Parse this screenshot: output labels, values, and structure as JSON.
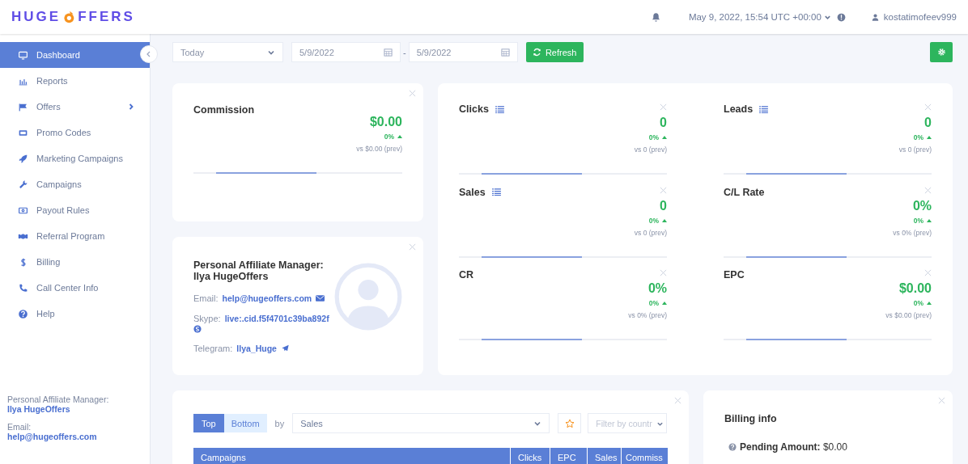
{
  "logo": {
    "left": "HUGE",
    "right": "FFERS"
  },
  "header": {
    "datetime": "May 9, 2022, 15:54 UTC +00:00",
    "user": "kostatimofeev999"
  },
  "sidebar": {
    "items": [
      {
        "label": "Dashboard",
        "selected": true,
        "has_submenu": false
      },
      {
        "label": "Reports",
        "selected": false,
        "has_submenu": false
      },
      {
        "label": "Offers",
        "selected": false,
        "has_submenu": true
      },
      {
        "label": "Promo Codes",
        "selected": false,
        "has_submenu": false
      },
      {
        "label": "Marketing Campaigns",
        "selected": false,
        "has_submenu": false
      },
      {
        "label": "Campaigns",
        "selected": false,
        "has_submenu": false
      },
      {
        "label": "Payout Rules",
        "selected": false,
        "has_submenu": false
      },
      {
        "label": "Referral Program",
        "selected": false,
        "has_submenu": false
      },
      {
        "label": "Billing",
        "selected": false,
        "has_submenu": false
      },
      {
        "label": "Call Center Info",
        "selected": false,
        "has_submenu": false
      },
      {
        "label": "Help",
        "selected": false,
        "has_submenu": false
      }
    ],
    "footer": [
      {
        "label": "Personal Affiliate Manager:",
        "value": "Ilya HugeOffers"
      },
      {
        "label": "Email:",
        "value": "help@hugeoffers.com"
      }
    ]
  },
  "toolbar": {
    "period": "Today",
    "date_from": "5/9/2022",
    "separator": "-",
    "date_to": "5/9/2022",
    "refresh": "Refresh"
  },
  "commission": {
    "title": "Commission",
    "value": "$0.00",
    "change": "0%",
    "prev": "vs $0.00 (prev)"
  },
  "manager": {
    "title": "Personal Affiliate Manager:",
    "name": "Ilya HugeOffers",
    "contacts": [
      {
        "kind": "email",
        "label": "Email:",
        "value": "help@hugeoffers.com"
      },
      {
        "kind": "skype",
        "label": "Skype:",
        "value": "live:.cid.f5f4701c39ba892f"
      },
      {
        "kind": "telegram",
        "label": "Telegram:",
        "value": "Ilya_Huge"
      }
    ]
  },
  "metrics": [
    {
      "title": "Clicks",
      "list_icon": true,
      "value": "0",
      "change": "0%",
      "prev": "vs 0 (prev)"
    },
    {
      "title": "Leads",
      "list_icon": true,
      "value": "0",
      "change": "0%",
      "prev": "vs 0 (prev)"
    },
    {
      "title": "Sales",
      "list_icon": true,
      "value": "0",
      "change": "0%",
      "prev": "vs 0 (prev)"
    },
    {
      "title": "C/L Rate",
      "list_icon": false,
      "value": "0%",
      "change": "0%",
      "prev": "vs 0% (prev)"
    },
    {
      "title": "CR",
      "list_icon": false,
      "value": "0%",
      "change": "0%",
      "prev": "vs 0% (prev)"
    },
    {
      "title": "EPC",
      "list_icon": false,
      "value": "$0.00",
      "change": "0%",
      "prev": "vs $0.00 (prev)"
    }
  ],
  "top_table": {
    "toggle": [
      {
        "label": "Top",
        "selected": true
      },
      {
        "label": "Bottom",
        "selected": false
      }
    ],
    "by": "by",
    "sort": "Sales",
    "country_placeholder": "Filter by countr",
    "columns": [
      "Campaigns",
      "Clicks",
      "EPC",
      "Sales",
      "Commiss"
    ]
  },
  "billing": {
    "title": "Billing info",
    "pending": "**Pending Amount:** $0.00"
  }
}
